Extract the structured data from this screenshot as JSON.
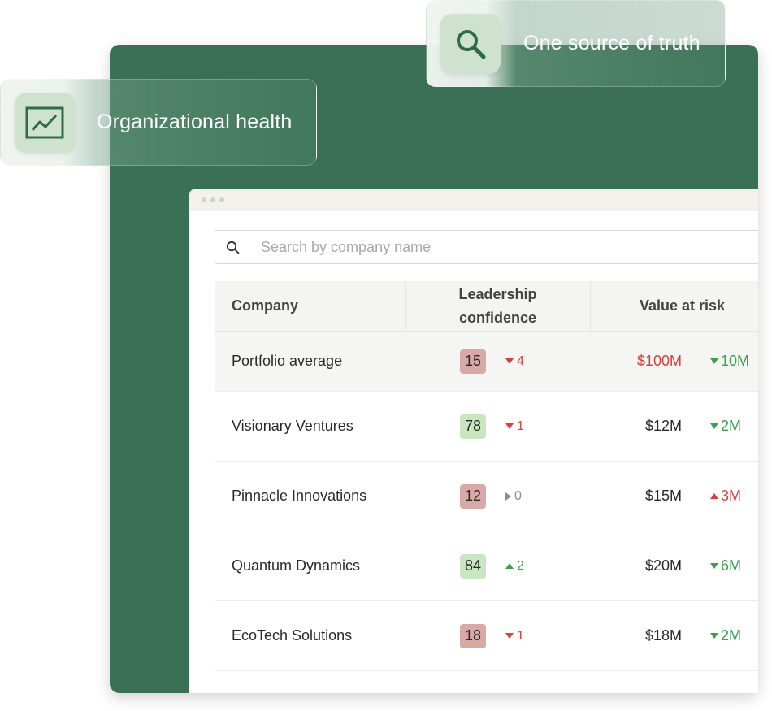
{
  "chips": {
    "health_label": "Organizational health",
    "truth_label": "One source of truth",
    "health_icon": "line-chart-icon",
    "truth_icon": "search-icon"
  },
  "search": {
    "placeholder": "Search by company name",
    "icon": "search-icon"
  },
  "table": {
    "headers": {
      "company": "Company",
      "confidence_line1": "Leadership",
      "confidence_line2": "confidence",
      "value_at_risk": "Value at risk"
    },
    "rows": [
      {
        "company": "Portfolio average",
        "score": "15",
        "score_color": "red",
        "conf_delta": "4",
        "conf_dir": "down",
        "conf_color": "red",
        "value": "$100M",
        "value_color": "red",
        "var_delta": "10M",
        "var_dir": "down",
        "var_color": "green"
      },
      {
        "company": "Visionary Ventures",
        "score": "78",
        "score_color": "green",
        "conf_delta": "1",
        "conf_dir": "down",
        "conf_color": "red",
        "value": "$12M",
        "value_color": "normal",
        "var_delta": "2M",
        "var_dir": "down",
        "var_color": "green"
      },
      {
        "company": "Pinnacle Innovations",
        "score": "12",
        "score_color": "red",
        "conf_delta": "0",
        "conf_dir": "right",
        "conf_color": "gray",
        "value": "$15M",
        "value_color": "normal",
        "var_delta": "3M",
        "var_dir": "up",
        "var_color": "red"
      },
      {
        "company": "Quantum Dynamics",
        "score": "84",
        "score_color": "green",
        "conf_delta": "2",
        "conf_dir": "up",
        "conf_color": "green",
        "value": "$20M",
        "value_color": "normal",
        "var_delta": "6M",
        "var_dir": "down",
        "var_color": "green"
      },
      {
        "company": "EcoTech Solutions",
        "score": "18",
        "score_color": "red",
        "conf_delta": "1",
        "conf_dir": "down",
        "conf_color": "red",
        "value": "$18M",
        "value_color": "normal",
        "var_delta": "2M",
        "var_dir": "down",
        "var_color": "green"
      }
    ]
  },
  "colors": {
    "panel_green": "#3a7156",
    "score_red": "#d9a9a6",
    "score_green": "#c8e6c1",
    "delta_red": "#d8403b",
    "delta_green": "#3aa04c"
  }
}
